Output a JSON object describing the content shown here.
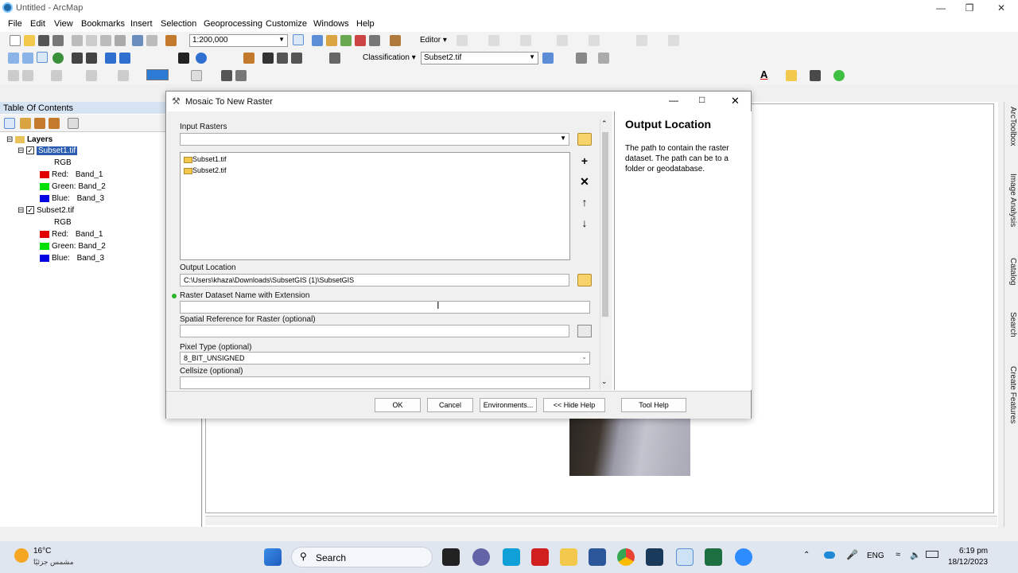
{
  "window": {
    "title": "Untitled - ArcMap"
  },
  "menu": [
    "File",
    "Edit",
    "View",
    "Bookmarks",
    "Insert",
    "Selection",
    "Geoprocessing",
    "Customize",
    "Windows",
    "Help"
  ],
  "toolbar": {
    "scale_value": "1:200,000",
    "editor_label": "Editor",
    "classification_label": "Classification",
    "layer_select_value": "Subset2.tif"
  },
  "toc": {
    "title": "Table Of Contents",
    "root": "Layers",
    "layers": [
      {
        "name": "Subset1.tif",
        "checked": "✓",
        "renderer": "RGB",
        "bands": [
          {
            "channel": "Red:",
            "band": "Band_1",
            "color": "#e00000"
          },
          {
            "channel": "Green:",
            "band": "Band_2",
            "color": "#00e000"
          },
          {
            "channel": "Blue:",
            "band": "Band_3",
            "color": "#0000e0"
          }
        ]
      },
      {
        "name": "Subset2.tif",
        "checked": "✓",
        "renderer": "RGB",
        "bands": [
          {
            "channel": "Red:",
            "band": "Band_1",
            "color": "#e00000"
          },
          {
            "channel": "Green:",
            "band": "Band_2",
            "color": "#00e000"
          },
          {
            "channel": "Blue:",
            "band": "Band_3",
            "color": "#0000e0"
          }
        ]
      }
    ]
  },
  "dialog": {
    "title": "Mosaic To New Raster",
    "input_rasters_label": "Input Rasters",
    "input_rasters_value": "",
    "rasters": [
      "Subset1.tif",
      "Subset2.tif"
    ],
    "output_location_label": "Output Location",
    "output_location_value": "C:\\Users\\khaza\\Downloads\\SubsetGIS (1)\\SubsetGIS",
    "dataset_name_label": "Raster Dataset Name with Extension",
    "dataset_name_value": "",
    "spatial_ref_label": "Spatial Reference for Raster (optional)",
    "spatial_ref_value": "",
    "pixel_type_label": "Pixel Type (optional)",
    "pixel_type_value": "8_BIT_UNSIGNED",
    "cellsize_label": "Cellsize (optional)",
    "cellsize_value": "",
    "help_title": "Output Location",
    "help_text": "The path to contain the raster dataset. The path can be to a folder or geodatabase.",
    "buttons": {
      "ok": "OK",
      "cancel": "Cancel",
      "environments": "Environments...",
      "hide_help": "<< Hide Help",
      "tool_help": "Tool Help"
    }
  },
  "right_dock": [
    "ArcToolbox",
    "Image Analysis",
    "Catalog",
    "Search",
    "Create Features"
  ],
  "taskbar": {
    "weather_temp": "16°C",
    "weather_desc": "مشمس جزئيًا",
    "search_label": "Search",
    "language": "ENG",
    "time": "6:19 pm",
    "date": "18/12/2023"
  }
}
